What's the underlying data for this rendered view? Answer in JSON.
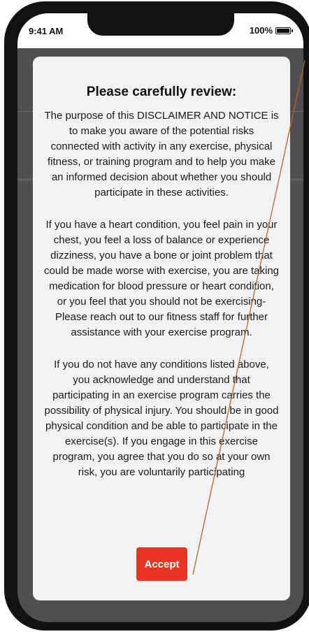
{
  "status_bar": {
    "time": "9:41 AM",
    "battery_percent": "100%",
    "battery_level": 1.0
  },
  "modal": {
    "title": "Please carefully review:",
    "paragraphs": [
      "The purpose of this DISCLAIMER AND NOTICE is to make you aware of the potential risks connected with activity in any exercise, physical fitness, or training program and to help you make an informed decision about whether you should participate in these activities.",
      "If you have a heart condition, you feel pain in your chest, you feel a loss of balance or experience dizziness, you have a bone or joint problem that could be made worse with exercise, you are taking medication for blood pressure or heart condition, or you feel that you should not be exercising- Please reach out to our fitness staff for further assistance with your exercise program.",
      "If you do not have any conditions listed above, you acknowledge and understand that participating in an exercise program carries the possibility of physical injury. You should be in good physical condition and be able to participate in the exercise(s). If you engage in this exercise program, you agree that you do so at your own risk, you are voluntarily participating"
    ],
    "accept_label": "Accept"
  },
  "colors": {
    "accent": "#ea3323",
    "modal_background": "#f2f2f4",
    "backdrop": "#4f4f52",
    "device_frame": "#111111",
    "annotation_line": "#b5651d"
  },
  "icons": {
    "battery": "battery-full-icon"
  }
}
